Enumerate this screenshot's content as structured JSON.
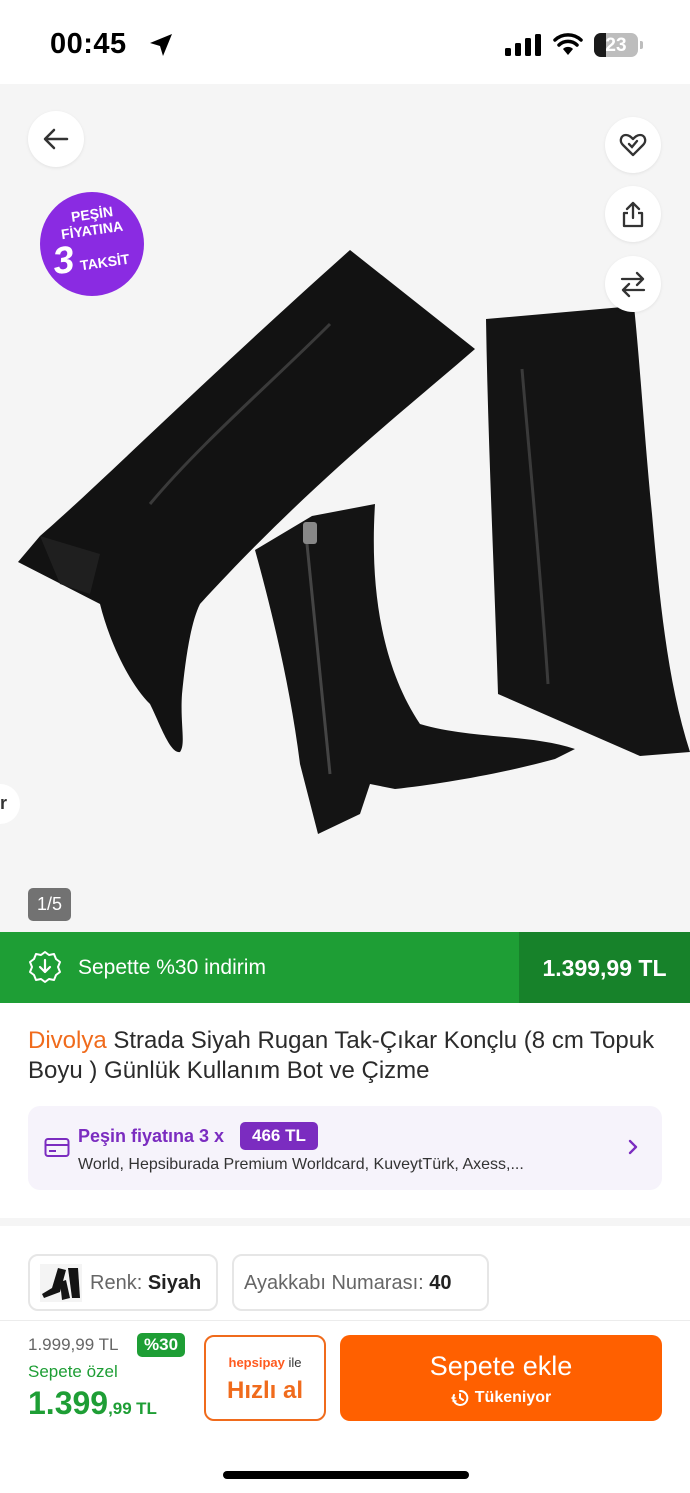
{
  "status_bar": {
    "time": "00:45",
    "battery": "23"
  },
  "gallery": {
    "promo_badge": {
      "line1": "PEŞİN",
      "line2": "FİYATINA",
      "number": "3",
      "line3": "TAKSİT"
    },
    "side_tab_letter": "r",
    "counter": "1/5",
    "icons": [
      "back-arrow-icon",
      "favorite-heart-icon",
      "share-icon",
      "compare-arrows-icon"
    ]
  },
  "discount_bar": {
    "text": "Sepette %30 indirim",
    "price": "1.399,99 TL",
    "color": "#1e9e35"
  },
  "product": {
    "brand": "Divolya",
    "title": " Strada Siyah Rugan Tak-Çıkar Konçlu  (8 cm Topuk Boyu ) Günlük Kullanım Bot ve Çizme"
  },
  "installment": {
    "label": "Peşin fiyatına 3 x",
    "amount": "466 TL",
    "banks": "World, Hepsiburada Premium Worldcard, KuveytTürk, Axess,..."
  },
  "variants": {
    "color_label": "Renk:",
    "color_value": "Siyah",
    "size_label": "Ayakkabı Numarası:",
    "size_value": "40"
  },
  "bottom_bar": {
    "old_price": "1.999,99 TL",
    "discount_badge": "%30",
    "special_label": "Sepete özel",
    "price_main": "1.399",
    "price_cents": ",99",
    "price_currency": "TL",
    "hepsipay_brand": "hepsipay",
    "hepsipay_suffix": "ile",
    "quick_buy": "Hızlı al",
    "add_to_cart": "Sepete ekle",
    "stock_status": "Tükeniyor",
    "accent_color": "#ff6000"
  }
}
